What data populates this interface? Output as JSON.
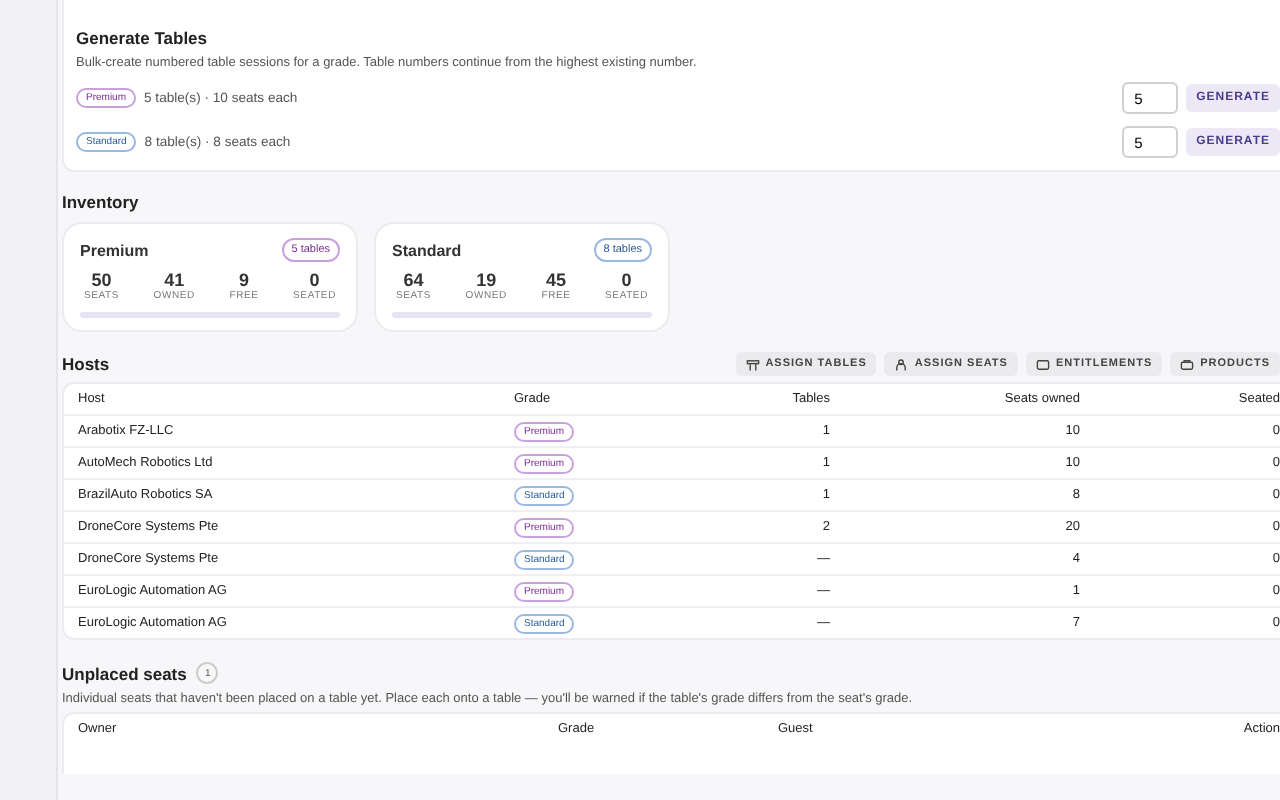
{
  "generate": {
    "title": "Generate Tables",
    "description": "Bulk-create numbered table sessions for a grade. Table numbers continue from the highest existing number.",
    "rows": [
      {
        "grade": {
          "kind": "premium",
          "label": "Premium"
        },
        "summary": "5 table(s) · 10 seats each",
        "value": "5",
        "button": "GENERATE"
      },
      {
        "grade": {
          "kind": "standard",
          "label": "Standard"
        },
        "summary": "8 table(s) · 8 seats each",
        "value": "5",
        "button": "GENERATE"
      }
    ]
  },
  "inventory": {
    "title": "Inventory",
    "cards": [
      {
        "kind": "premium",
        "name": "Premium",
        "badge": "5 tables",
        "level": 0,
        "stats": [
          {
            "value": "50",
            "label": "SEATS"
          },
          {
            "value": "41",
            "label": "OWNED"
          },
          {
            "value": "9",
            "label": "FREE"
          },
          {
            "value": "0",
            "label": "SEATED"
          }
        ]
      },
      {
        "kind": "standard",
        "name": "Standard",
        "badge": "8 tables",
        "level": 0,
        "stats": [
          {
            "value": "64",
            "label": "SEATS"
          },
          {
            "value": "19",
            "label": "OWNED"
          },
          {
            "value": "45",
            "label": "FREE"
          },
          {
            "value": "0",
            "label": "SEATED"
          }
        ]
      }
    ]
  },
  "hosts": {
    "title": "Hosts",
    "actions": [
      {
        "kind": "tables",
        "label": "ASSIGN TABLES"
      },
      {
        "kind": "seats",
        "label": "ASSIGN SEATS"
      },
      {
        "kind": "entitlements",
        "label": "ENTITLEMENTS"
      },
      {
        "kind": "products",
        "label": "PRODUCTS"
      }
    ],
    "columns": [
      "Host",
      "Grade",
      "Tables",
      "Seats owned",
      "Seated"
    ],
    "rows": [
      {
        "host": "Arabotix FZ-LLC",
        "grade": {
          "kind": "premium",
          "label": "Premium"
        },
        "tables": "1",
        "seats_owned": "10",
        "seated": "0"
      },
      {
        "host": "AutoMech Robotics Ltd",
        "grade": {
          "kind": "premium",
          "label": "Premium"
        },
        "tables": "1",
        "seats_owned": "10",
        "seated": "0"
      },
      {
        "host": "BrazilAuto Robotics SA",
        "grade": {
          "kind": "standard",
          "label": "Standard"
        },
        "tables": "1",
        "seats_owned": "8",
        "seated": "0"
      },
      {
        "host": "DroneCore Systems Pte",
        "grade": {
          "kind": "premium",
          "label": "Premium"
        },
        "tables": "2",
        "seats_owned": "20",
        "seated": "0"
      },
      {
        "host": "DroneCore Systems Pte",
        "grade": {
          "kind": "standard",
          "label": "Standard"
        },
        "tables": "—",
        "seats_owned": "4",
        "seated": "0"
      },
      {
        "host": "EuroLogic Automation AG",
        "grade": {
          "kind": "premium",
          "label": "Premium"
        },
        "tables": "—",
        "seats_owned": "1",
        "seated": "0"
      },
      {
        "host": "EuroLogic Automation AG",
        "grade": {
          "kind": "standard",
          "label": "Standard"
        },
        "tables": "—",
        "seats_owned": "7",
        "seated": "0"
      }
    ]
  },
  "unplaced": {
    "title": "Unplaced seats",
    "count": "1",
    "description": "Individual seats that haven't been placed on a table yet. Place each onto a table — you'll be warned if the table's grade differs from the seat's grade.",
    "columns": [
      "Owner",
      "Grade",
      "Guest",
      "Action"
    ]
  }
}
